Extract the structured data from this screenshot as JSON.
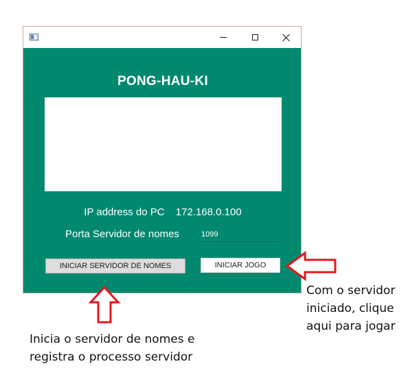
{
  "window": {
    "app_title": "PONG-HAU-KI",
    "ip_label": "IP address do PC",
    "ip_value": "172.168.0.100",
    "port_label": "Porta Servidor de nomes",
    "port_value": "1099",
    "buttons": {
      "start_name_server": "INICIAR SERVIDOR DE NOMES",
      "start_game": "INICIAR JOGO"
    }
  },
  "annotations": {
    "right_lines": [
      "Com o servidor",
      "iniciado, clique",
      "aqui para jogar"
    ],
    "bottom_lines": [
      "Inicia o servidor de nomes e",
      "registra o processo servidor"
    ]
  },
  "colors": {
    "window_background": "#00896f",
    "arrow_stroke": "#e8141c"
  }
}
